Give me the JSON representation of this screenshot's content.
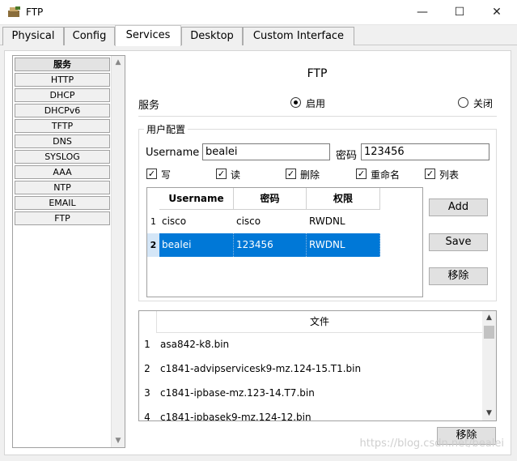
{
  "window": {
    "title": "FTP",
    "minimize_glyph": "—",
    "maximize_glyph": "☐",
    "close_glyph": "✕"
  },
  "tabs": [
    {
      "label": "Physical"
    },
    {
      "label": "Config"
    },
    {
      "label": "Services"
    },
    {
      "label": "Desktop"
    },
    {
      "label": "Custom Interface"
    }
  ],
  "active_tab": "Services",
  "services": [
    "服务",
    "HTTP",
    "DHCP",
    "DHCPv6",
    "TFTP",
    "DNS",
    "SYSLOG",
    "AAA",
    "NTP",
    "EMAIL",
    "FTP"
  ],
  "active_service": "服务",
  "ftp": {
    "heading": "FTP",
    "service_label": "服务",
    "on_label": "启用",
    "off_label": "关闭",
    "service_state": "on",
    "user_config_title": "用户配置",
    "username_label": "Username",
    "username_value": "bealei",
    "password_label": "密码",
    "password_value": "123456",
    "permissions": [
      {
        "label": "写",
        "checked": true
      },
      {
        "label": "读",
        "checked": true
      },
      {
        "label": "删除",
        "checked": true
      },
      {
        "label": "重命名",
        "checked": true
      },
      {
        "label": "列表",
        "checked": true
      }
    ],
    "user_table": {
      "headers": [
        "Username",
        "密码",
        "权限"
      ],
      "rows": [
        {
          "num": "1",
          "username": "cisco",
          "password": "cisco",
          "perm": "RWDNL"
        },
        {
          "num": "2",
          "username": "bealei",
          "password": "123456",
          "perm": "RWDNL"
        }
      ],
      "selected_row": 2
    },
    "add_button": "Add",
    "save_button": "Save",
    "remove_button": "移除",
    "file_table": {
      "header": "文件",
      "rows": [
        {
          "num": "1",
          "name": "asa842-k8.bin"
        },
        {
          "num": "2",
          "name": "c1841-advipservicesk9-mz.124-15.T1.bin"
        },
        {
          "num": "3",
          "name": "c1841-ipbase-mz.123-14.T7.bin"
        },
        {
          "num": "4",
          "name": "c1841-ipbasek9-mz.124-12.bin"
        }
      ]
    },
    "file_remove_button": "移除"
  },
  "watermark": "https://blog.csdn.net/bealei",
  "colors": {
    "selection": "#0078d7",
    "panel_bg": "#f0f0f0"
  }
}
